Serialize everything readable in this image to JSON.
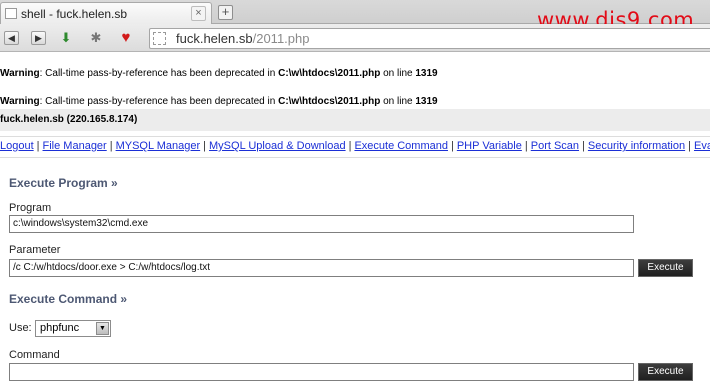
{
  "browser": {
    "tab_title": "shell - fuck.helen.sb",
    "tab_close": "×",
    "new_tab": "+",
    "url_host": "fuck.helen.sb",
    "url_path": "/2011.php",
    "watermark": "www.dis9.com"
  },
  "warnings": [
    {
      "label": "Warning",
      "text": ": Call-time pass-by-reference has been deprecated in ",
      "file": "C:\\w\\htdocs\\2011.php",
      "on": " on line ",
      "line": "1319"
    },
    {
      "label": "Warning",
      "text": ": Call-time pass-by-reference has been deprecated in ",
      "file": "C:\\w\\htdocs\\2011.php",
      "on": " on line ",
      "line": "1319"
    }
  ],
  "host_info": "fuck.helen.sb (220.165.8.174)",
  "nav": {
    "links": [
      "Logout",
      "File Manager",
      "MYSQL Manager",
      "MySQL Upload & Download",
      "Execute Command",
      "PHP Variable",
      "Port Scan",
      "Security information",
      "Eval PHP C"
    ],
    "separator": "|"
  },
  "execute_program": {
    "title": "Execute Program »",
    "program_label": "Program",
    "program_value": "c:\\windows\\system32\\cmd.exe",
    "parameter_label": "Parameter",
    "parameter_value": "/c C:/w/htdocs/door.exe > C:/w/htdocs/log.txt",
    "button": "Execute"
  },
  "execute_command": {
    "title": "Execute Command »",
    "use_label": "Use:",
    "use_value": "phpfunc",
    "command_label": "Command",
    "command_value": "",
    "button": "Execute"
  },
  "icons": [
    "back-icon",
    "forward-icon",
    "download-icon",
    "tools-icon",
    "heart-icon",
    "page-icon",
    "dropdown-arrow-icon"
  ],
  "colors": {
    "link": "#1b2fd6",
    "section_title": "#4d5873",
    "watermark": "#e20b17",
    "button": "#2a2a2a"
  }
}
